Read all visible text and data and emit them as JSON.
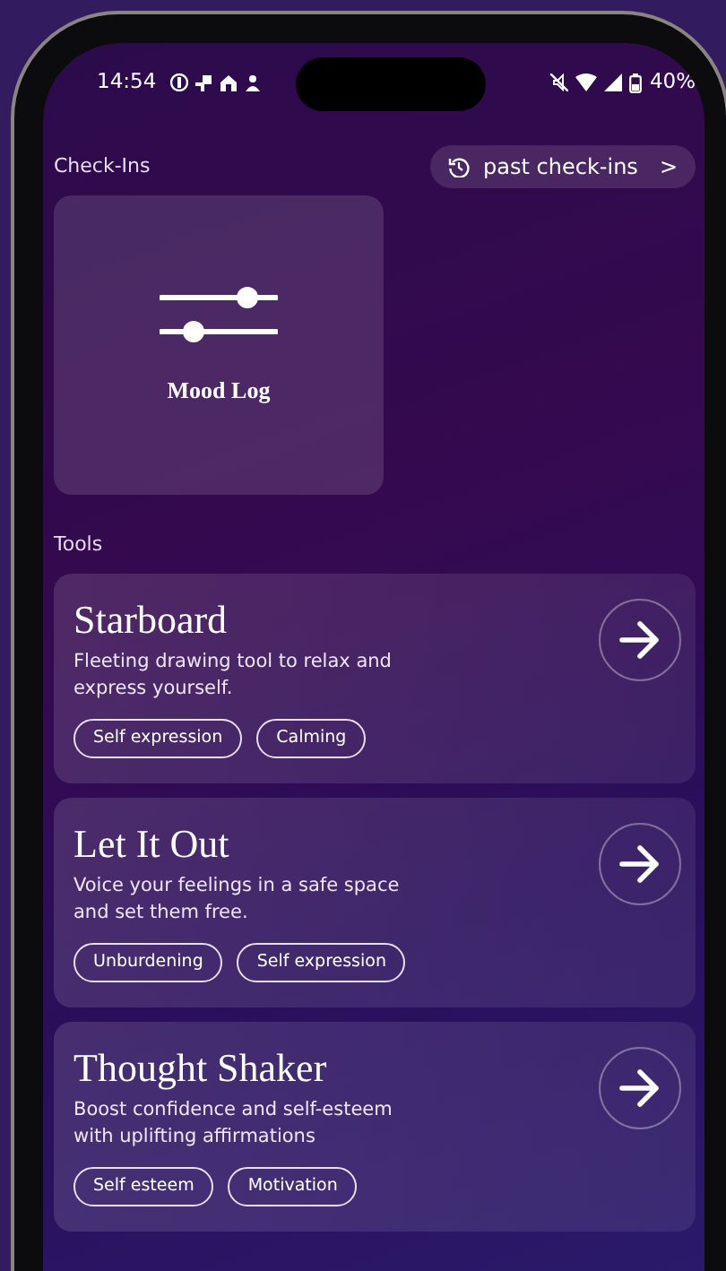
{
  "status_bar": {
    "time": "14:54",
    "battery": "40%"
  },
  "checkins": {
    "title": "Check-Ins",
    "history_button": "past check-ins",
    "chevron": ">",
    "mood_log": {
      "label": "Mood Log"
    }
  },
  "tools": {
    "title": "Tools",
    "items": [
      {
        "title": "Starboard",
        "description": "Fleeting drawing tool to relax and express yourself.",
        "tags": [
          "Self expression",
          "Calming"
        ]
      },
      {
        "title": "Let It Out",
        "description": "Voice your feelings in a safe space and set them free.",
        "tags": [
          "Unburdening",
          "Self expression"
        ]
      },
      {
        "title": "Thought Shaker",
        "description": "Boost confidence and self-esteem with uplifting affirmations",
        "tags": [
          "Self esteem",
          "Motivation"
        ]
      }
    ]
  }
}
